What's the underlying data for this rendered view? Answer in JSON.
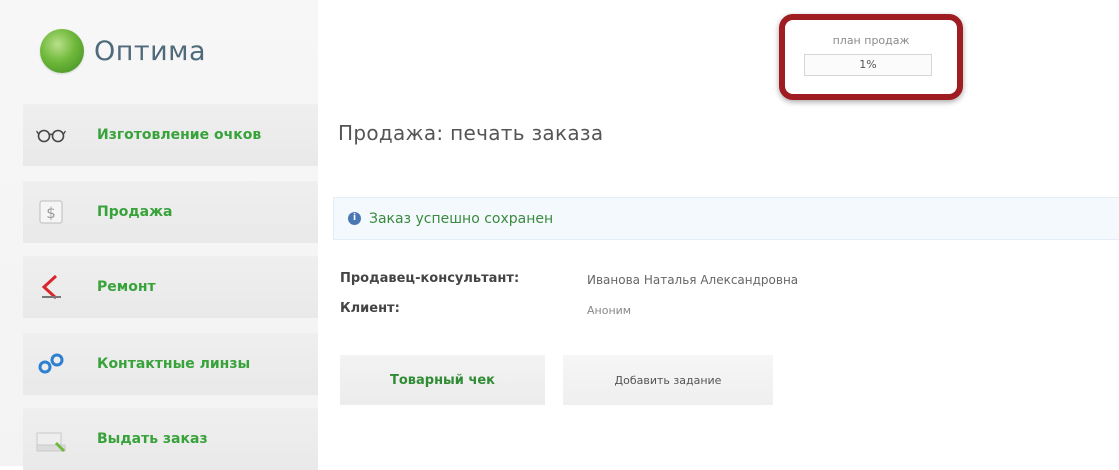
{
  "app": {
    "name": "Оптима"
  },
  "sales_plan": {
    "label": "план продаж",
    "value": "1%"
  },
  "sidebar": {
    "items": [
      {
        "label": "Изготовление очков",
        "icon": "glasses-icon"
      },
      {
        "label": "Продажа",
        "icon": "cash-icon"
      },
      {
        "label": "Ремонт",
        "icon": "repair-icon"
      },
      {
        "label": "Контактные линзы",
        "icon": "contact-lens-icon"
      },
      {
        "label": "Выдать заказ",
        "icon": "box-icon"
      }
    ]
  },
  "main": {
    "title": "Продажа: печать заказа",
    "alert": {
      "text": "Заказ успешно сохранен"
    },
    "details": [
      {
        "label": "Продавец-консультант:",
        "value": "Иванова Наталья Александровна"
      },
      {
        "label": "Клиент:",
        "value": "Аноним"
      }
    ],
    "buttons": {
      "receipt": "Товарный чек",
      "add_task": "Добавить задание"
    }
  },
  "colors": {
    "accent_green": "#38a33a",
    "highlight_red": "#9e1c22",
    "alert_bg": "#f4f9fd"
  }
}
